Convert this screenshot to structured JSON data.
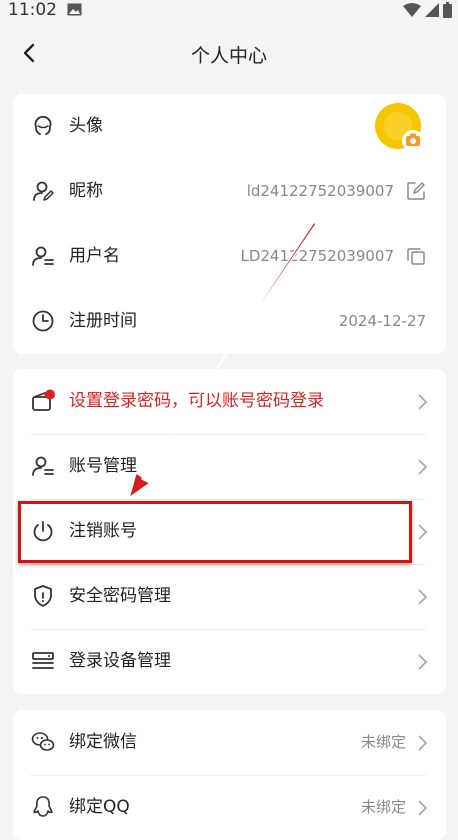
{
  "status": {
    "time": "11:02"
  },
  "header": {
    "title": "个人中心"
  },
  "profile": {
    "avatar_label": "头像",
    "nickname_label": "昵称",
    "nickname_value": "ld24122752039007",
    "username_label": "用户名",
    "username_value": "LD24122752039007",
    "regtime_label": "注册时间",
    "regtime_value": "2024-12-27"
  },
  "account": {
    "set_password_label": "设置登录密码，可以账号密码登录",
    "manage_label": "账号管理",
    "cancel_label": "注销账号",
    "security_label": "安全密码管理",
    "devices_label": "登录设备管理"
  },
  "binding": {
    "wechat_label": "绑定微信",
    "wechat_status": "未绑定",
    "qq_label": "绑定QQ",
    "qq_status": "未绑定"
  },
  "colors": {
    "accent_red": "#e02020",
    "highlight": "#d81010",
    "avatar_yellow": "#f7c600"
  }
}
